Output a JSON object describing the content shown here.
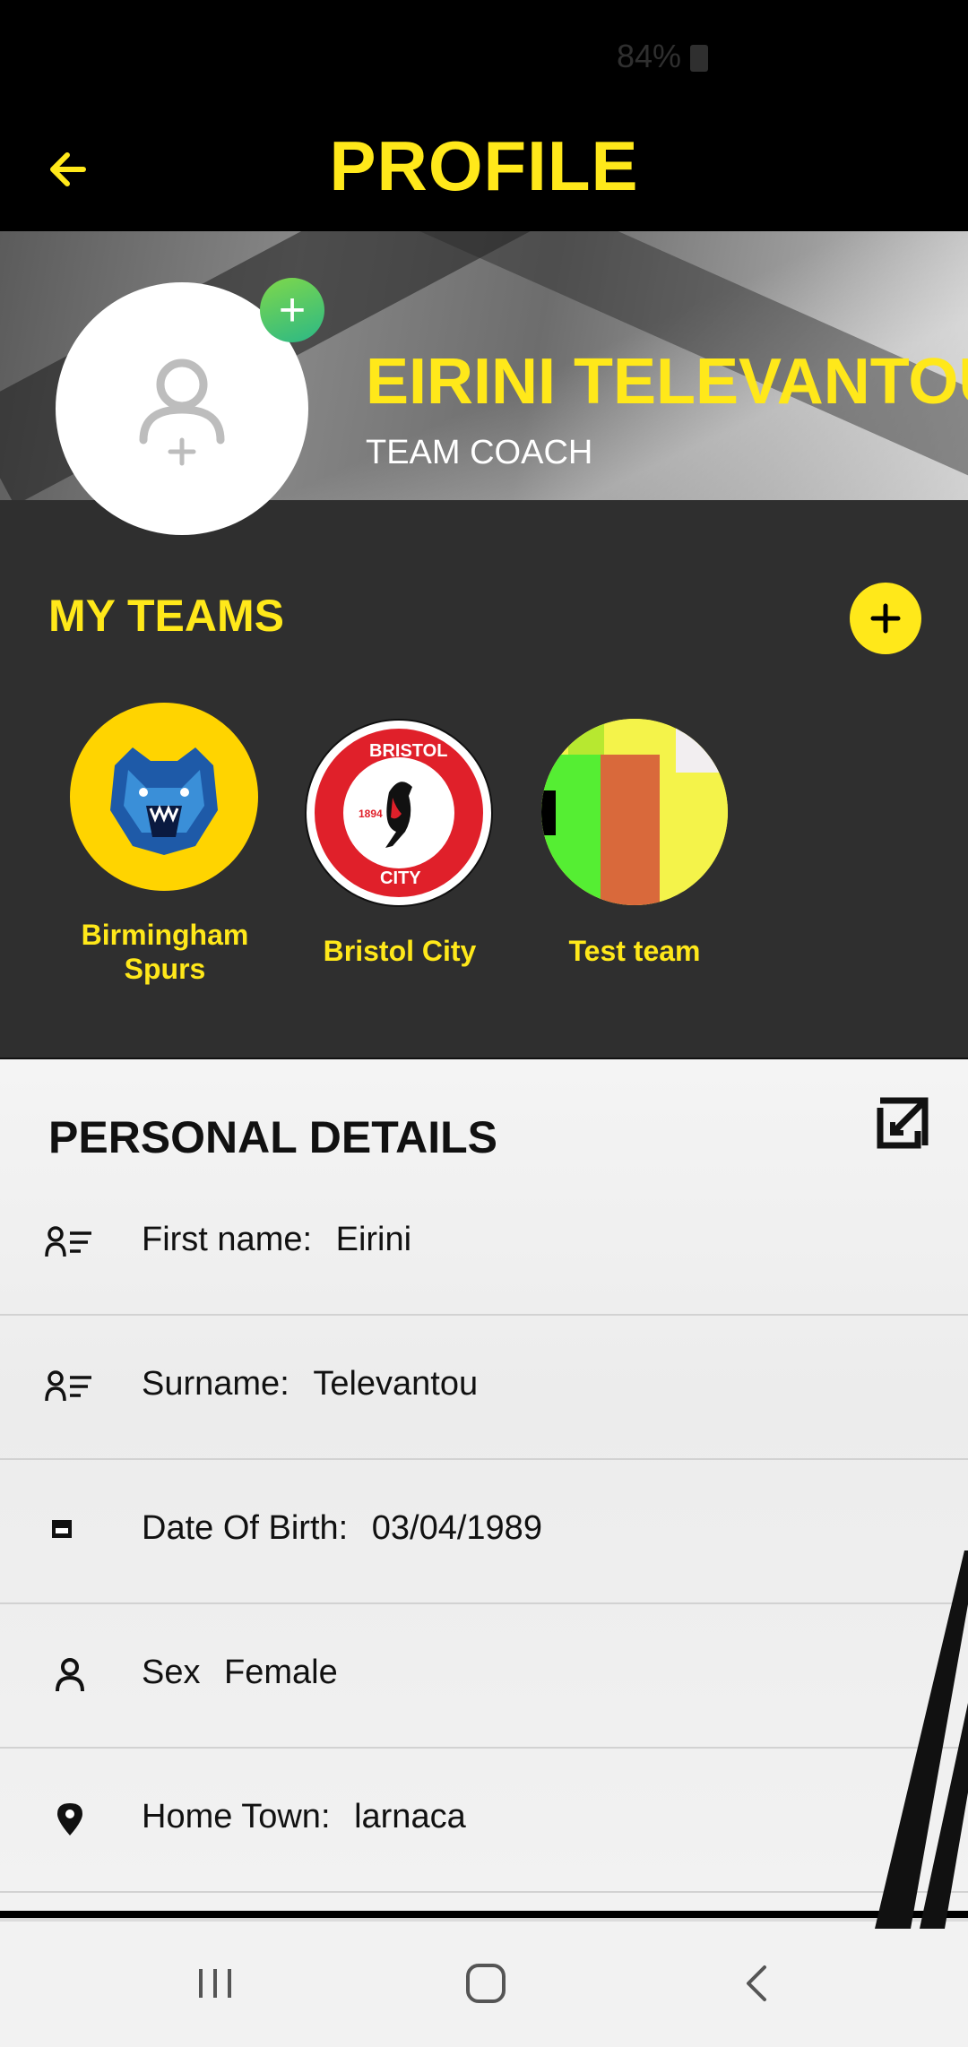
{
  "status_bar": {
    "battery": "84%"
  },
  "header": {
    "title": "PROFILE"
  },
  "profile": {
    "name": "EIRINI TELEVANTOU",
    "role": "TEAM COACH"
  },
  "teams": {
    "title": "MY TEAMS",
    "items": [
      {
        "name_line1": "Birmingham",
        "name_line2": "Spurs"
      },
      {
        "name_line1": "Bristol City",
        "name_line2": ""
      },
      {
        "name_line1": "Test team",
        "name_line2": ""
      }
    ]
  },
  "personal_details": {
    "title": "PERSONAL DETAILS",
    "rows": [
      {
        "label": "First name:",
        "value": "Eirini",
        "icon": "person-list-icon"
      },
      {
        "label": "Surname:",
        "value": "Televantou",
        "icon": "person-list-icon"
      },
      {
        "label": "Date Of Birth:",
        "value": "03/04/1989",
        "icon": "calendar-icon"
      },
      {
        "label": "Sex",
        "value": "Female",
        "icon": "person-icon"
      },
      {
        "label": "Home Town:",
        "value": "larnaca",
        "icon": "location-pin-icon"
      }
    ]
  },
  "colors": {
    "accent": "#ffe81a",
    "dark": "#2f2f2f",
    "header": "#000000"
  }
}
